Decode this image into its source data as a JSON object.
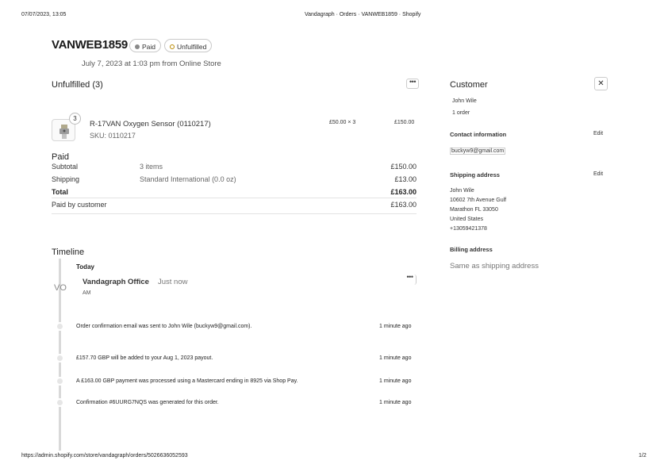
{
  "header": {
    "datetime": "07/07/2023, 13:05",
    "page_title": "Vandagraph · Orders · VANWEB1859 · Shopify"
  },
  "order": {
    "number": "VANWEB1859",
    "badges": {
      "paid": "Paid",
      "fulfillment": "Unfulfilled"
    },
    "subtitle": "July 7, 2023 at 1:03 pm from Online Store"
  },
  "unfulfilled": {
    "title": "Unfulfilled (3)",
    "item": {
      "qty_badge": "3",
      "name": "R-17VAN Oxygen Sensor (0110217)",
      "sku": "SKU: 0110217",
      "unit_price": "£50.00 × 3",
      "total": "£150.00"
    }
  },
  "payment": {
    "title": "Paid",
    "rows": [
      {
        "label": "Subtotal",
        "detail": "3 items",
        "amount": "£150.00"
      },
      {
        "label": "Shipping",
        "detail": "Standard International (0.0 oz)",
        "amount": "£13.00"
      }
    ],
    "total": {
      "label": "Total",
      "amount": "£163.00"
    },
    "paid_by_customer": {
      "label": "Paid by customer",
      "amount": "£163.00"
    }
  },
  "timeline": {
    "title": "Timeline",
    "day": "Today",
    "comment": {
      "initials": "VO",
      "author": "Vandagraph Office",
      "time": "Just now",
      "sub": "AM"
    },
    "events": [
      {
        "text": "Order confirmation email was sent to John Wile (buckyw9@gmail.com).",
        "time": "1 minute ago"
      },
      {
        "text": "£157.70 GBP will be added to your Aug 1, 2023 payout.",
        "time": "1 minute ago"
      },
      {
        "text": "A £163.00 GBP payment was processed using a Mastercard ending in 8925 via Shop Pay.",
        "time": "1 minute ago"
      },
      {
        "text": "Confirmation #6UURG7NQS was generated for this order.",
        "time": "1 minute ago"
      }
    ]
  },
  "customer": {
    "title": "Customer",
    "name": "John Wile",
    "orders": "1 order",
    "contact": {
      "title": "Contact information",
      "edit": "Edit",
      "email": "buckyw9@gmail.com"
    },
    "shipping": {
      "title": "Shipping address",
      "edit": "Edit",
      "lines": [
        "John Wile",
        "10602 7th Avenue Gulf",
        "Marathon FL 33050",
        "United States",
        "+13059421378"
      ]
    },
    "billing": {
      "title": "Billing address",
      "value": "Same as shipping address"
    }
  },
  "footer": {
    "url": "https://admin.shopify.com/store/vandagraph/orders/5026636052593",
    "page": "1/2"
  },
  "colors": {
    "paid_dot": "#8a8a8a",
    "unfulfilled_ring": "#b98900",
    "timeline": "#d9d9d9"
  }
}
